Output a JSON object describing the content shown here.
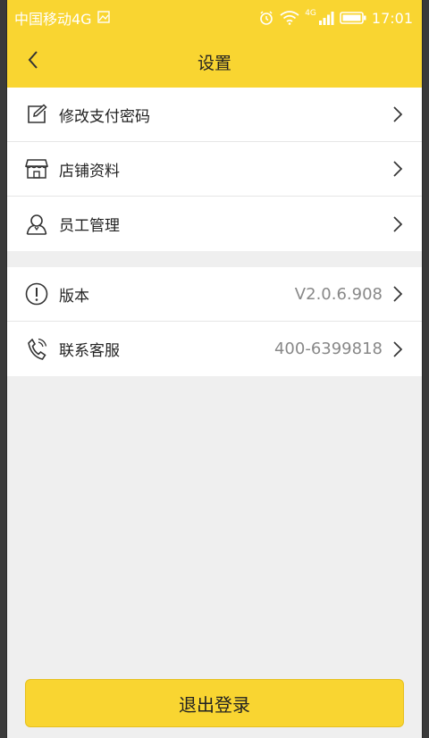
{
  "status_bar": {
    "carrier": "中国移动4G",
    "time": "17:01",
    "network": "4G"
  },
  "header": {
    "title": "设置"
  },
  "settings_group_1": {
    "items": [
      {
        "label": "修改支付密码",
        "icon": "edit-icon"
      },
      {
        "label": "店铺资料",
        "icon": "store-icon"
      },
      {
        "label": "员工管理",
        "icon": "user-icon"
      }
    ]
  },
  "settings_group_2": {
    "items": [
      {
        "label": "版本",
        "value": "V2.0.6.908",
        "icon": "info-icon"
      },
      {
        "label": "联系客服",
        "value": "400-6399818",
        "icon": "phone-icon"
      }
    ]
  },
  "logout": {
    "label": "退出登录"
  },
  "colors": {
    "accent": "#f9d531",
    "background": "#efefef",
    "text": "#222222",
    "secondary_text": "#888888"
  }
}
